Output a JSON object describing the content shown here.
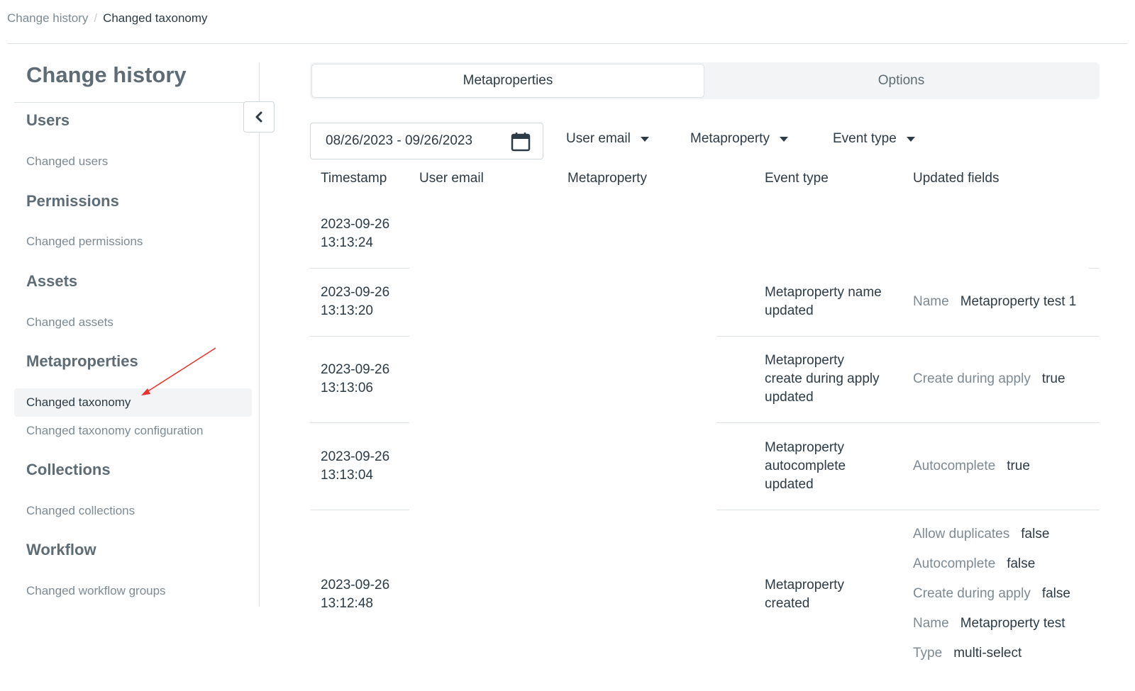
{
  "breadcrumb": {
    "parent": "Change history",
    "separator": "/",
    "current": "Changed taxonomy"
  },
  "sidebar": {
    "title": "Change history",
    "sections": {
      "users": {
        "heading": "Users",
        "items": [
          "Changed users"
        ]
      },
      "permissions": {
        "heading": "Permissions",
        "items": [
          "Changed permissions"
        ]
      },
      "assets": {
        "heading": "Assets",
        "items": [
          "Changed assets"
        ]
      },
      "metaproperties": {
        "heading": "Metaproperties",
        "items": [
          "Changed taxonomy",
          "Changed taxonomy configuration"
        ]
      },
      "collections": {
        "heading": "Collections",
        "items": [
          "Changed collections"
        ]
      },
      "workflow": {
        "heading": "Workflow",
        "items": [
          "Changed workflow groups"
        ]
      }
    },
    "active_item": "Changed taxonomy",
    "collapse_icon": "chevron-left-icon"
  },
  "tabs": [
    {
      "label": "Metaproperties",
      "active": true
    },
    {
      "label": "Options",
      "active": false
    }
  ],
  "filters": {
    "date_range": "08/26/2023 - 09/26/2023",
    "date_icon": "calendar-icon",
    "user_email": "User email",
    "metaproperty": "Metaproperty",
    "event_type": "Event type"
  },
  "table": {
    "headers": [
      "Timestamp",
      "User email",
      "Metaproperty",
      "Event type",
      "Updated fields"
    ],
    "rows": [
      {
        "date": "2023-09-26",
        "time": "13:13:24",
        "event": [],
        "fields": []
      },
      {
        "date": "2023-09-26",
        "time": "13:13:20",
        "event": [
          "Metaproperty name",
          "updated"
        ],
        "fields": [
          {
            "label": "Name",
            "value": "Metaproperty test 1"
          }
        ]
      },
      {
        "date": "2023-09-26",
        "time": "13:13:06",
        "event": [
          "Metaproperty",
          "create during apply",
          "updated"
        ],
        "fields": [
          {
            "label": "Create during apply",
            "value": "true"
          }
        ]
      },
      {
        "date": "2023-09-26",
        "time": "13:13:04",
        "event": [
          "Metaproperty",
          "autocomplete",
          "updated"
        ],
        "fields": [
          {
            "label": "Autocomplete",
            "value": "true"
          }
        ]
      },
      {
        "date": "2023-09-26",
        "time": "13:12:48",
        "event": [
          "Metaproperty",
          "created"
        ],
        "fields": [
          {
            "label": "Allow duplicates",
            "value": "false"
          },
          {
            "label": "Autocomplete",
            "value": "false"
          },
          {
            "label": "Create during apply",
            "value": "false"
          },
          {
            "label": "Name",
            "value": "Metaproperty test"
          },
          {
            "label": "Type",
            "value": "multi-select"
          }
        ]
      }
    ]
  },
  "colors": {
    "text": "#2c3b46",
    "muted": "#7d8a93",
    "heading": "#5e6c76",
    "border": "#dde2e5",
    "active_bg": "#f2f4f5",
    "annotation_arrow": "#e8322b"
  }
}
